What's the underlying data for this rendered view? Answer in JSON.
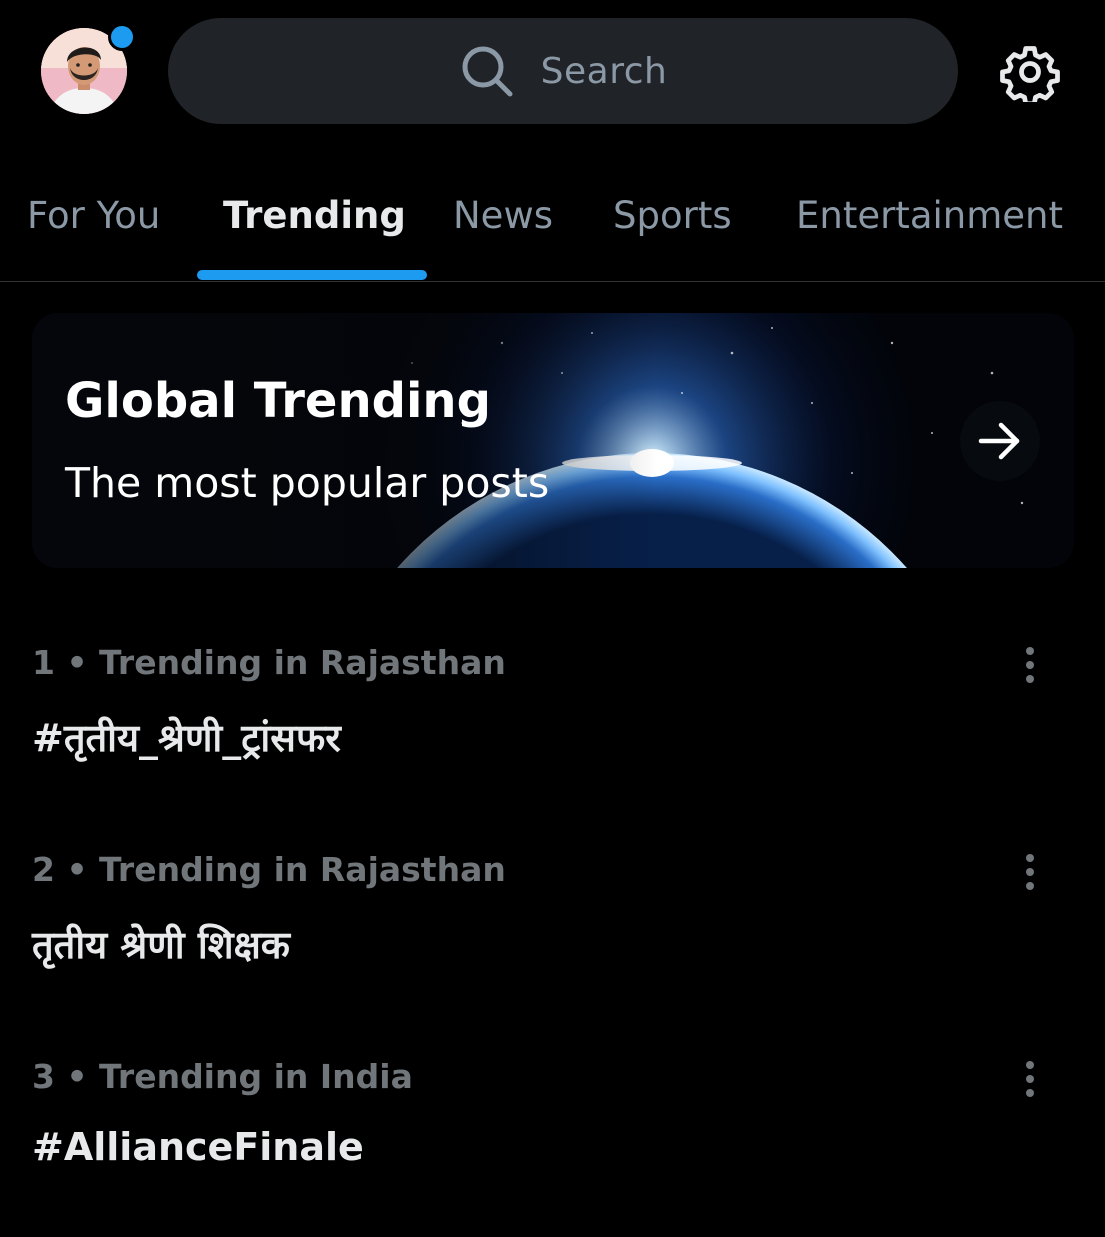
{
  "header": {
    "search_placeholder": "Search",
    "avatar_icon": "user-avatar",
    "notification_color": "#1d9bf0",
    "settings_icon": "gear-icon"
  },
  "tabs": [
    {
      "label": "For You",
      "active": false
    },
    {
      "label": "Trending",
      "active": true
    },
    {
      "label": "News",
      "active": false
    },
    {
      "label": "Sports",
      "active": false
    },
    {
      "label": "Entertainment",
      "active": false
    }
  ],
  "banner": {
    "title": "Global Trending",
    "subtitle": "The most popular posts",
    "arrow_icon": "arrow-right-icon"
  },
  "trends": [
    {
      "meta": "1 • Trending in Rajasthan",
      "title": "#तृतीय_श्रेणी_ट्रांसफर"
    },
    {
      "meta": "2 • Trending in Rajasthan",
      "title": "तृतीय श्रेणी शिक्षक"
    },
    {
      "meta": "3 • Trending in India",
      "title": "#AllianceFinale"
    }
  ],
  "colors": {
    "background": "#000000",
    "accent": "#1d9bf0",
    "text_primary": "#e7e9ea",
    "text_secondary": "#71767b",
    "search_bg": "#202327"
  }
}
